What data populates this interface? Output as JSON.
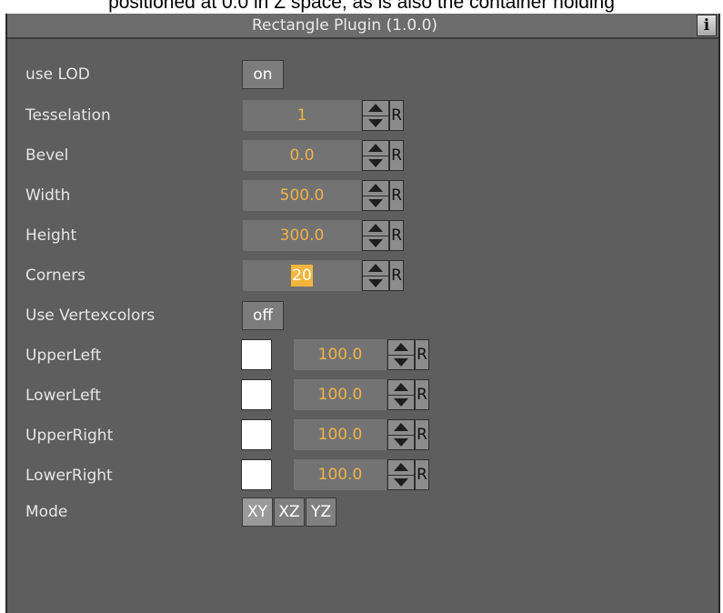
{
  "caption": "positioned at 0.0 in Z space, as is also the container holding",
  "panel": {
    "title": "Rectangle Plugin (1.0.0)",
    "info_label": "i"
  },
  "rows": {
    "use_lod": {
      "label": "use LOD",
      "toggle": "on"
    },
    "tesselation": {
      "label": "Tesselation",
      "value": "1",
      "reset": "R"
    },
    "bevel": {
      "label": "Bevel",
      "value": "0.0",
      "reset": "R"
    },
    "width": {
      "label": "Width",
      "value": "500.0",
      "reset": "R"
    },
    "height": {
      "label": "Height",
      "value": "300.0",
      "reset": "R"
    },
    "corners": {
      "label": "Corners",
      "value": "20",
      "reset": "R"
    },
    "use_vertexcolors": {
      "label": "Use Vertexcolors",
      "toggle": "off"
    },
    "upper_left": {
      "label": "UpperLeft",
      "value": "100.0",
      "reset": "R",
      "color": "#ffffff"
    },
    "lower_left": {
      "label": "LowerLeft",
      "value": "100.0",
      "reset": "R",
      "color": "#ffffff"
    },
    "upper_right": {
      "label": "UpperRight",
      "value": "100.0",
      "reset": "R",
      "color": "#ffffff"
    },
    "lower_right": {
      "label": "LowerRight",
      "value": "100.0",
      "reset": "R",
      "color": "#ffffff"
    },
    "mode": {
      "label": "Mode",
      "options": [
        "XY",
        "XZ",
        "YZ"
      ],
      "selected": "XY"
    }
  },
  "colors": {
    "panel_bg": "#5e5e5e",
    "value_text": "#f0b24a",
    "selection": "#f3b63c"
  },
  "icons": {
    "spinner": "up-down-arrows-icon",
    "info": "info-icon"
  }
}
